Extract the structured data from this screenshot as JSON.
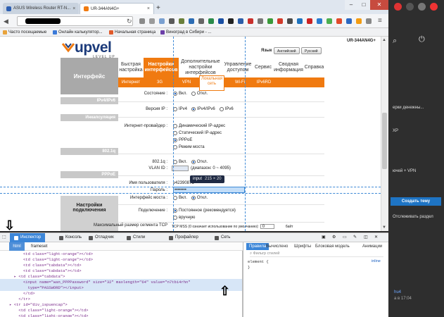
{
  "browser": {
    "tabs": [
      {
        "label": "ASUS Wireless Router RT-N...",
        "active": false
      },
      {
        "label": "UR-344AN4G+",
        "active": true
      }
    ],
    "bookmarks": [
      "Часто посещаемые",
      "Онлайн калькулятор...",
      "Начальная страница",
      "Виноград в Сибири - ..."
    ]
  },
  "router": {
    "logo": "upvel",
    "logo_sub": "LEVEL UP",
    "model": "UR-344AN4G+",
    "lang_label": "Язык",
    "lang_english": "Английский",
    "lang_russian": "Русский",
    "section_title": "Интерфейс",
    "main_tabs": [
      "Быстрая настройка",
      "Настройки интерфейсов",
      "Дополнительные настройки интерфейсов",
      "Управление доступом",
      "Сервис",
      "Сводная информация",
      "Справка"
    ],
    "sub_tabs": [
      "Интернет",
      "3G",
      "VPN",
      "Локальная сеть",
      "Wi-Fi",
      "IPv6RD"
    ],
    "group_ipv4v6": "IPv4/IPv6",
    "group_encap": "Инкапсуляция",
    "group_8021q": "802.1q",
    "group_pppoe": "PPPoE",
    "group_conn": "Настройки подключения",
    "rows": {
      "state_label": "Состояние :",
      "state_on": "Вкл.",
      "state_off": "Откл.",
      "version_label": "Версия IP :",
      "ver_ipv4": "IPv4",
      "ver_ipv4v6": "IPv4/IPv6",
      "ver_ipv6": "IPv6",
      "isp_label": "Интернет-провайдер :",
      "isp_dynamic": "Динамический IP-адрес",
      "isp_static": "Статический IP-адрес",
      "isp_pppoe": "PPPoE",
      "isp_bridge": "Режим моста",
      "q_label": "802.1q :",
      "q_on": "Вкл.",
      "q_off": "Откл.",
      "vlan_label": "VLAN ID :",
      "vlan_hint": "(диапазон: 0 ~ 4095)",
      "user_label": "Имя пользователя :",
      "user_value": "v42390871",
      "pass_label": "Пароль :",
      "pass_value": "••••••••",
      "bridge_label": "Интерфейс моста :",
      "bridge_on": "Вкл.",
      "bridge_off": "Откл.",
      "conn_label": "Подключение :",
      "conn_always": "Постоянное (рекомендуется)",
      "conn_manual": "вручную",
      "mss_label": "Максимальный размер сегмента TCP",
      "mss_value": "TCP MSS (0 означает использование по умолчанию):",
      "mss_unit": "байт",
      "mss_num": "0"
    },
    "tooltip_tag": "input",
    "tooltip_size": "215 × 20"
  },
  "devtools": {
    "tabs": [
      "Инспектор",
      "Консоль",
      "Отладчик",
      "Стили",
      "Профайлер",
      "Сеть"
    ],
    "breadcrumbs": [
      "html",
      "frameset"
    ],
    "markup": [
      {
        "indent": 4,
        "text": "<td class=\"light-orange\"></td>"
      },
      {
        "indent": 4,
        "text": "<td class=\"light-orange\"></td>"
      },
      {
        "indent": 4,
        "text": "<td class=\"tabdata\"></td>"
      },
      {
        "indent": 4,
        "text": "<td class=\"tabdata\"></td>"
      },
      {
        "indent": 3,
        "text": "<td class=\"tabdata\">"
      },
      {
        "indent": 4,
        "text": "<input name=\"wan_PPPPassword\" size=\"32\" maxlength=\"64\" value=\"n7tbi4rhn\""
      },
      {
        "indent": 5,
        "text": "type=\"PASSWORD\"></input>"
      },
      {
        "indent": 4,
        "text": "</td>"
      },
      {
        "indent": 3,
        "text": "</tr>"
      },
      {
        "indent": 2,
        "text": "<tr id=\"div_ispuencap\">"
      },
      {
        "indent": 3,
        "text": "<td class=\"light-orange\"></td>"
      },
      {
        "indent": 3,
        "text": "<td class=\"light-orange\"></td>"
      }
    ],
    "rules_tabs": [
      "Правила",
      "Вычислено",
      "Шрифты",
      "Блоковая модель",
      "Анимации"
    ],
    "filter_placeholder": "Фильтр стилей",
    "element_rule": "element {",
    "element_close": "}",
    "inline_label": "inline"
  },
  "sidebar": {
    "items": [
      "ерки денежны...",
      "XP",
      "ючей + VPN"
    ],
    "button": "Создать тему",
    "track": "Отслеживать раздел",
    "bottom": [
      "hu4",
      "а в 17:04"
    ]
  }
}
